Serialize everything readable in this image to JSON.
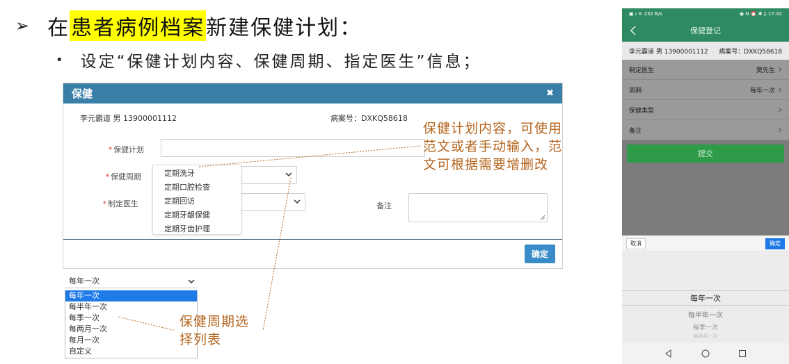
{
  "slide": {
    "heading_pre": "在",
    "heading_highlight": "患者病例档案",
    "heading_post": "新建保健计划：",
    "sub": "设定“保健计划内容、保健周期、指定医生”信息；"
  },
  "modal": {
    "title": "保健",
    "close": "✖",
    "patient_info": "李元霸道 男 13900001112",
    "record_no": "病案号：DXKQ58618",
    "fields": {
      "plan_label": "保健计划",
      "period_label": "保健周期",
      "doctor_label": "制定医生",
      "remark_label": "备注",
      "required_mark": "*"
    },
    "plan_options": [
      "定期洗牙",
      "定期口腔检查",
      "定期回访",
      "定期牙龈保健",
      "定期牙齿护理"
    ],
    "confirm": "确定"
  },
  "period_select": {
    "selected": "每年一次",
    "options": [
      "每年一次",
      "每半年一次",
      "每季一次",
      "每两月一次",
      "每月一次",
      "自定义"
    ]
  },
  "annotations": {
    "plan_note_lines": [
      "保健计划内容，可使用",
      "范文或者手动输入，范",
      "文可根据需要增删改"
    ],
    "period_note_lines": [
      "保健周期选",
      "择列表"
    ]
  },
  "phone": {
    "status_left": "▣ ᵢₗ ≋ 232 B/s",
    "status_right": "◉ N ⏰ ✱ ▯ 17:32",
    "title": "保健登记",
    "patient": "李元霸道 男 13900001112",
    "record_no": "病案号：DXKQ58618",
    "rows": [
      {
        "label": "制定医生",
        "value": "樊先生"
      },
      {
        "label": "周期",
        "value": "每年一次"
      },
      {
        "label": "保健类型",
        "value": ""
      },
      {
        "label": "备注",
        "value": ""
      }
    ],
    "submit": "提交",
    "picker_cancel": "取消",
    "picker_ok": "确定",
    "picker_items": [
      "每年一次",
      "每半年一次",
      "每季一次",
      "每两月一次"
    ]
  }
}
